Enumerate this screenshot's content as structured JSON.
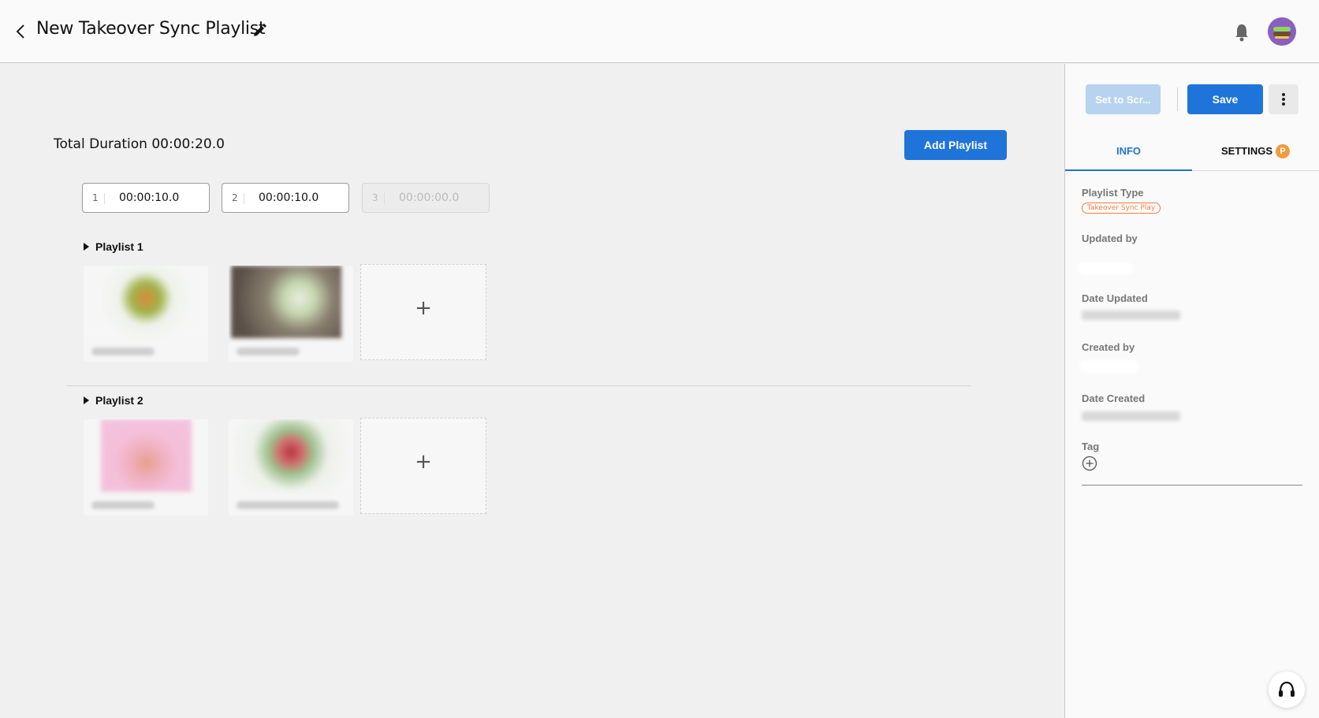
{
  "header": {
    "title": "New Takeover Sync Playlist"
  },
  "main": {
    "total_duration_label": "Total Duration 00:00:20.0",
    "add_playlist_label": "Add Playlist",
    "slots": [
      {
        "num": "1",
        "value": "00:00:10.0"
      },
      {
        "num": "2",
        "value": "00:00:10.0"
      },
      {
        "num": "3",
        "value": "00:00:00.0"
      }
    ],
    "playlists": [
      {
        "name": "Playlist 1"
      },
      {
        "name": "Playlist 2"
      }
    ],
    "add_tile_symbol": "+"
  },
  "panel": {
    "set_screen_label": "Set to Scr...",
    "save_label": "Save",
    "tabs": [
      {
        "label": "INFO"
      },
      {
        "label": "SETTINGS",
        "badge": "P"
      }
    ],
    "playlist_type_label": "Playlist Type",
    "playlist_type_value": "Takeover Sync Play",
    "updated_by_label": "Updated by",
    "date_updated_label": "Date Updated",
    "created_by_label": "Created by",
    "date_created_label": "Date Created",
    "tag_label": "Tag"
  },
  "colors": {
    "accent": "#1f74d9",
    "disabled_button": "#b7d3f0",
    "chip": "#f07a3c",
    "badge": "#f29a3c"
  },
  "icons": [
    "back-arrow-icon",
    "pencil-icon",
    "bell-icon",
    "avatar",
    "more-vertical-icon",
    "plus-circle-icon",
    "headset-icon"
  ]
}
